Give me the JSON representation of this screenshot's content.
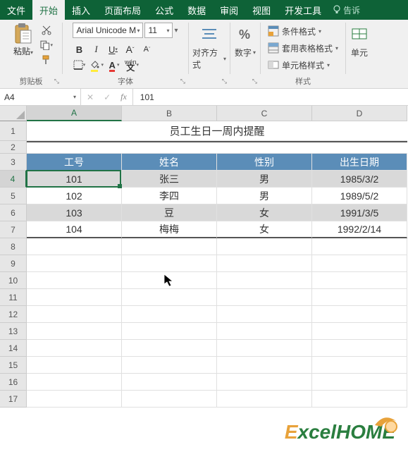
{
  "tabs": [
    "文件",
    "开始",
    "插入",
    "页面布局",
    "公式",
    "数据",
    "审阅",
    "视图",
    "开发工具"
  ],
  "tell": "告诉",
  "ribbon": {
    "paste": "粘贴",
    "clipboard": "剪贴板",
    "fontName": "Arial Unicode M",
    "fontSize": "11",
    "fontGroup": "字体",
    "align": "对齐方式",
    "number": "数字",
    "condFmt": "条件格式",
    "tableFmt": "套用表格格式",
    "cellStyle": "单元格样式",
    "styles": "样式",
    "cellsGroup": "单元"
  },
  "nameBox": "A4",
  "formulaBar": "101",
  "cols": [
    "A",
    "B",
    "C",
    "D"
  ],
  "title": "员工生日一周内提醒",
  "headers": [
    "工号",
    "姓名",
    "性别",
    "出生日期"
  ],
  "rows": [
    {
      "id": "101",
      "name": "张三",
      "sex": "男",
      "dob": "1985/3/2"
    },
    {
      "id": "102",
      "name": "李四",
      "sex": "男",
      "dob": "1989/5/2"
    },
    {
      "id": "103",
      "name": "豆",
      "sex": "女",
      "dob": "1991/3/5"
    },
    {
      "id": "104",
      "name": "梅梅",
      "sex": "女",
      "dob": "1992/2/14"
    }
  ],
  "logo": {
    "e": "E",
    "rest": "xcelHOME"
  }
}
